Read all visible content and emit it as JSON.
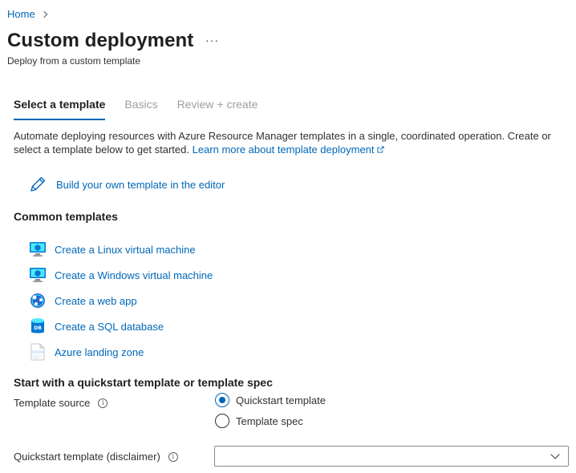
{
  "breadcrumb": {
    "home": "Home"
  },
  "header": {
    "title": "Custom deployment",
    "more": "···",
    "subtitle": "Deploy from a custom template"
  },
  "tabs": [
    {
      "label": "Select a template",
      "active": true
    },
    {
      "label": "Basics",
      "active": false
    },
    {
      "label": "Review + create",
      "active": false
    }
  ],
  "description": {
    "text": "Automate deploying resources with Azure Resource Manager templates in a single, coordinated operation. Create or select a template below to get started.",
    "learn_more": "Learn more about template deployment"
  },
  "build": {
    "label": "Build your own template in the editor",
    "icon": "pencil-icon"
  },
  "common": {
    "heading": "Common templates",
    "items": [
      {
        "label": "Create a Linux virtual machine",
        "icon": "vm-icon"
      },
      {
        "label": "Create a Windows virtual machine",
        "icon": "vm-icon"
      },
      {
        "label": "Create a web app",
        "icon": "web-app-icon"
      },
      {
        "label": "Create a SQL database",
        "icon": "sql-database-icon"
      },
      {
        "label": "Azure landing zone",
        "icon": "json-file-icon"
      }
    ]
  },
  "quickstart": {
    "heading": "Start with a quickstart template or template spec",
    "source_label": "Template source",
    "options": [
      {
        "label": "Quickstart template",
        "checked": true
      },
      {
        "label": "Template spec",
        "checked": false
      }
    ],
    "template_label": "Quickstart template (disclaimer)",
    "template_value": ""
  },
  "colors": {
    "accent": "#0067b8",
    "text": "#323130",
    "muted": "#a19f9d"
  }
}
